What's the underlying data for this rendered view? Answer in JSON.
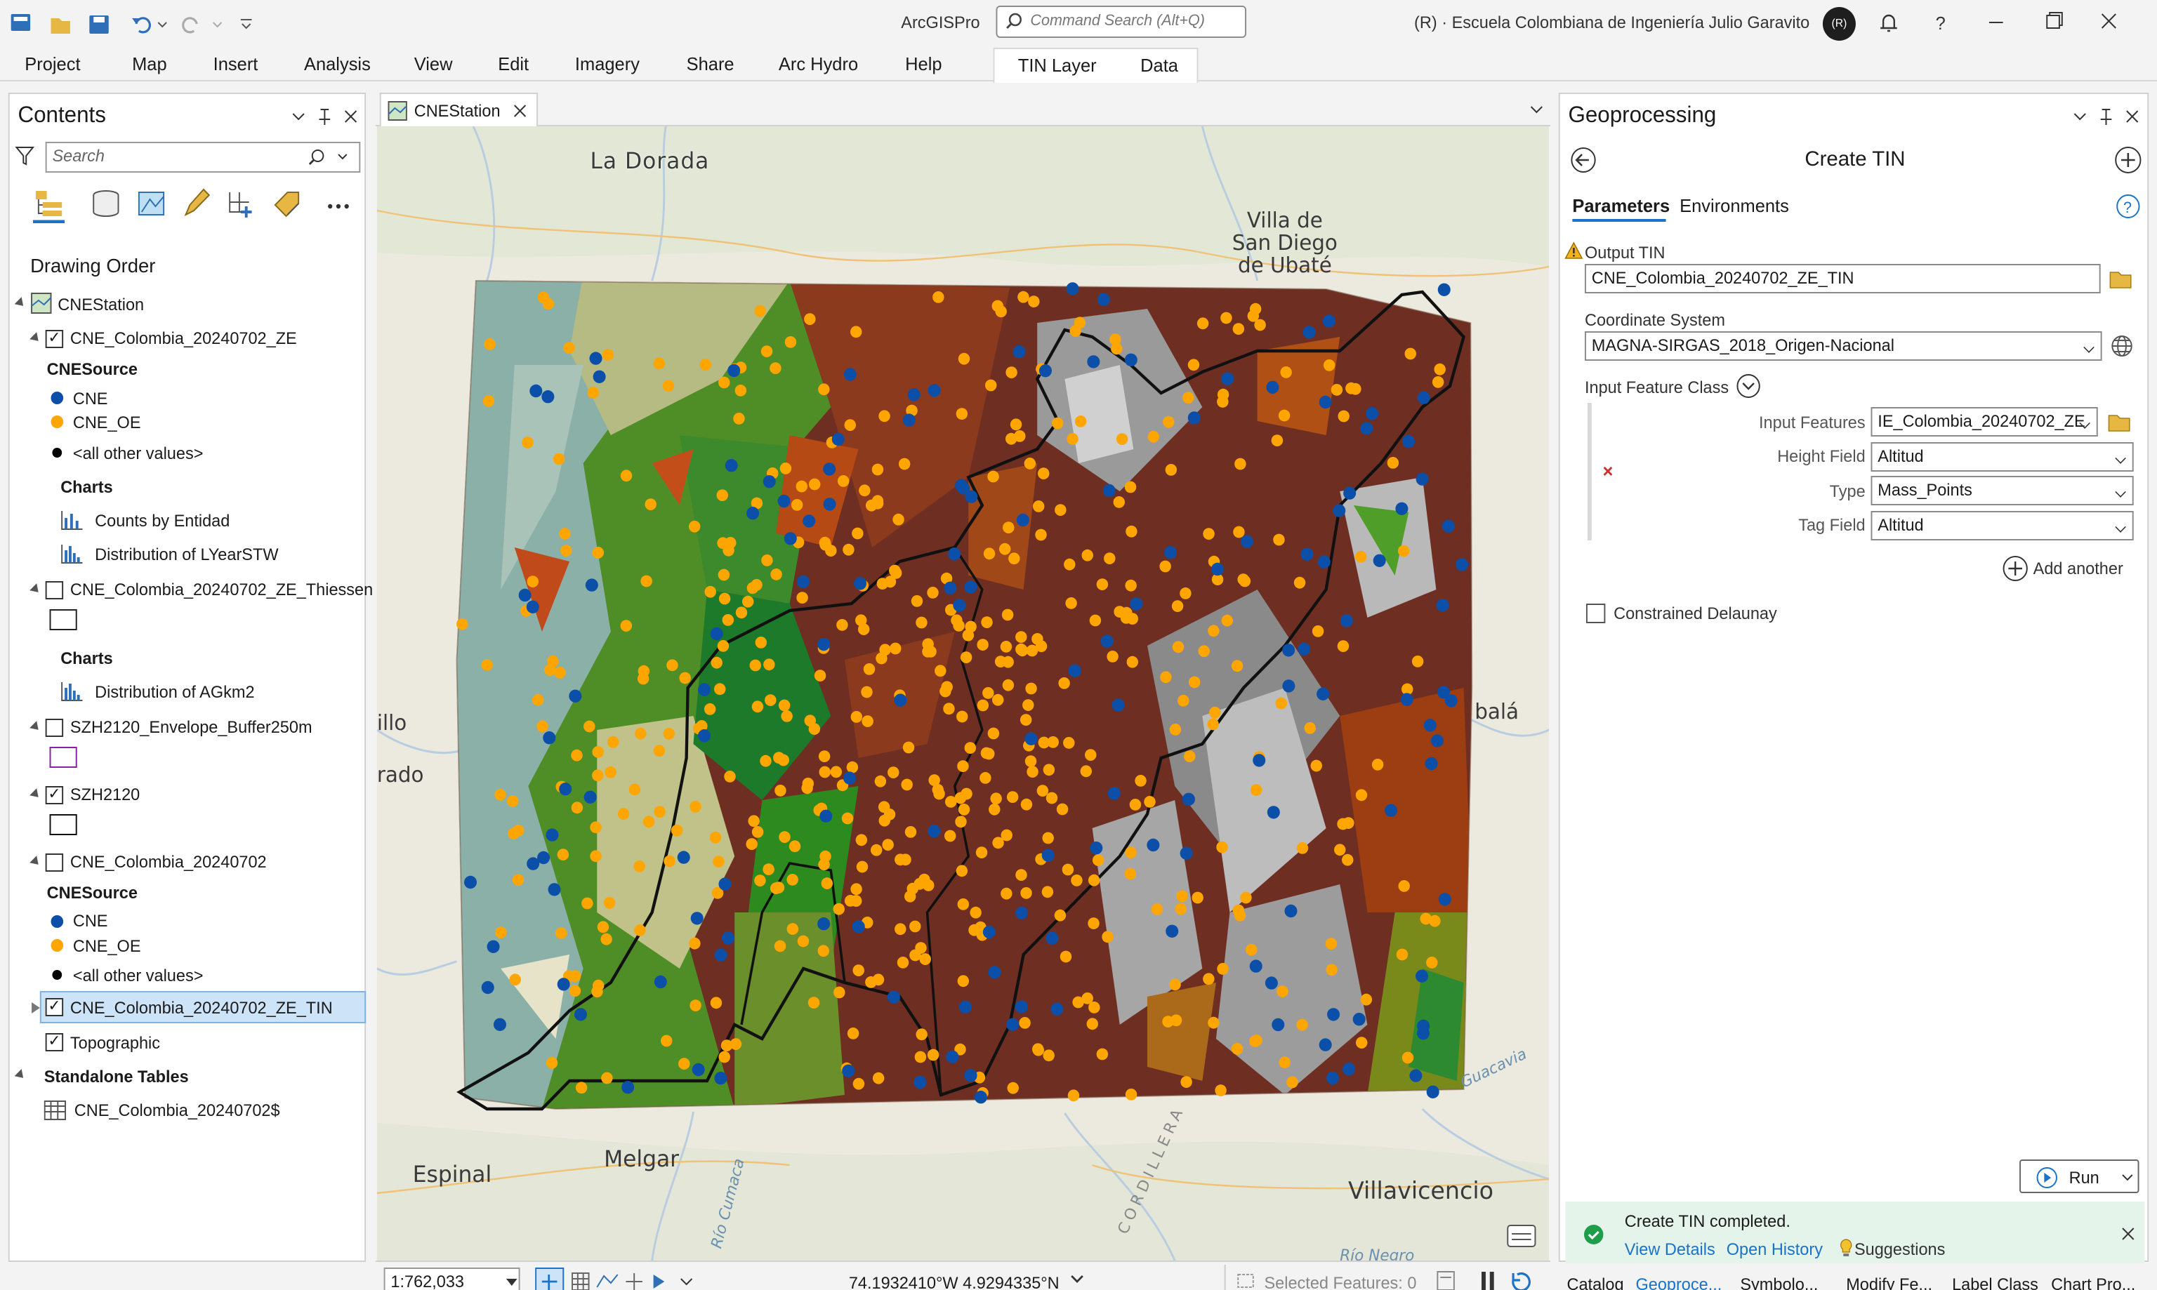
{
  "app": {
    "title": "ArcGISPro",
    "search_placeholder": "Command Search (Alt+Q)",
    "user": "(R) · Escuela Colombiana de Ingeniería Julio Garavito",
    "avatar": "(R)"
  },
  "ribbon": {
    "tabs": [
      "Project",
      "Map",
      "Insert",
      "Analysis",
      "View",
      "Edit",
      "Imagery",
      "Share",
      "Arc Hydro",
      "Help"
    ],
    "context_tabs": [
      "TIN Layer",
      "Data"
    ]
  },
  "contents": {
    "title": "Contents",
    "search_placeholder": "Search",
    "section": "Drawing Order",
    "map": "CNEStation",
    "layer1": {
      "name": "CNE_Colombia_20240702_ZE",
      "field": "CNESource",
      "c1": "CNE",
      "c2": "CNE_OE",
      "c3": "<all other values>",
      "charts": "Charts",
      "chart1": "Counts by Entidad",
      "chart2": "Distribution of LYearSTW"
    },
    "layer2": {
      "name": "CNE_Colombia_20240702_ZE_Thiessen",
      "charts": "Charts",
      "chart1": "Distribution of AGkm2"
    },
    "layer3": {
      "name": "SZH2120_Envelope_Buffer250m"
    },
    "layer4": {
      "name": "SZH2120"
    },
    "layer5": {
      "name": "CNE_Colombia_20240702",
      "field": "CNESource",
      "c1": "CNE",
      "c2": "CNE_OE",
      "c3": "<all other values>"
    },
    "layer6": {
      "name": "CNE_Colombia_20240702_ZE_TIN"
    },
    "layer7": {
      "name": "Topographic"
    },
    "tables_header": "Standalone Tables",
    "table1": "CNE_Colombia_20240702$"
  },
  "map": {
    "tab": "CNEStation",
    "labels": {
      "la_dorada": "La Dorada",
      "villa1": "Villa de",
      "villa2": "San Diego",
      "villa3": "de Ubaté",
      "illo": "illo",
      "rado": "rado",
      "bala": "balá",
      "espinal": "Espinal",
      "melgar": "Melgar",
      "villavicencio": "Villavicencio",
      "guacavia": "Guacavia",
      "cordillera": "CORDILLERA",
      "rio_cumaca": "Río Cumaca",
      "rio_negro": "Río Negro"
    },
    "scale": "1:762,033",
    "coords": "74.1932410°W 4.9294335°N",
    "selected": "Selected Features: 0"
  },
  "geoprocessing": {
    "title": "Geoprocessing",
    "tool": "Create TIN",
    "tab_params": "Parameters",
    "tab_env": "Environments",
    "output_label": "Output TIN",
    "output_value": "CNE_Colombia_20240702_ZE_TIN",
    "cs_label": "Coordinate System",
    "cs_value": "MAGNA-SIRGAS_2018_Origen-Nacional",
    "ifc_label": "Input Feature Class",
    "input_features_label": "Input Features",
    "input_features_value": "IE_Colombia_20240702_ZE",
    "height_label": "Height Field",
    "height_value": "Altitud",
    "type_label": "Type",
    "type_value": "Mass_Points",
    "tag_label": "Tag Field",
    "tag_value": "Altitud",
    "add_another": "Add another",
    "constrained": "Constrained Delaunay",
    "run": "Run",
    "status": "Create TIN completed.",
    "view_details": "View Details",
    "open_history": "Open History",
    "suggestions": "Suggestions",
    "bottom_tabs": [
      "Catalog",
      "Geoproce...",
      "Symbolo...",
      "Modify Fe...",
      "Label Class",
      "Chart Pro..."
    ]
  },
  "colors": {
    "accent": "#1a73c8",
    "cne": "#0b4fa8",
    "cne_oe": "#ffa500",
    "tin_brown": "#6e2f22",
    "success": "#1e9e4a"
  }
}
